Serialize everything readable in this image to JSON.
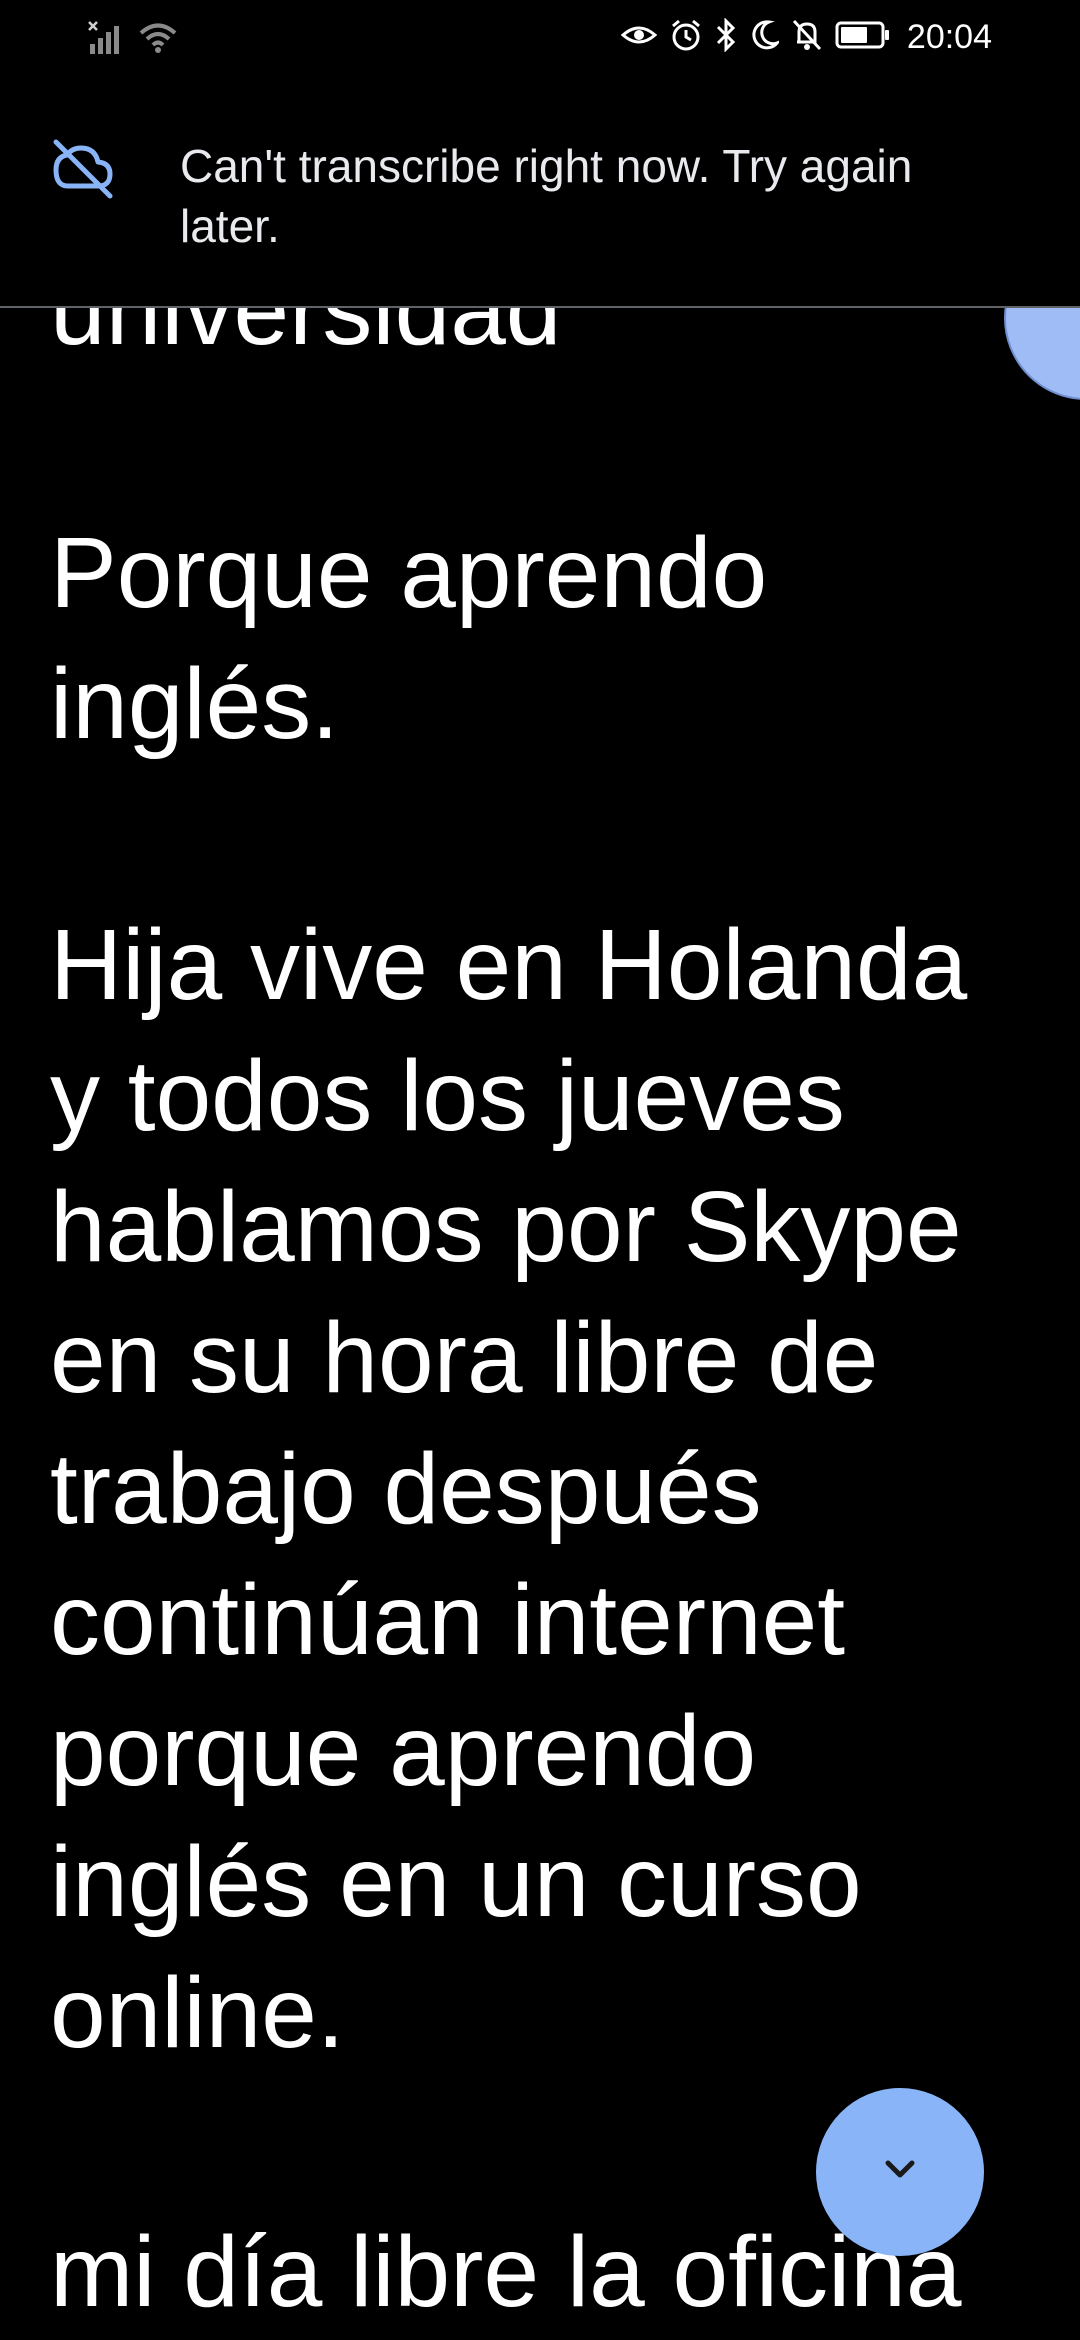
{
  "status_bar": {
    "time": "20:04",
    "icons": [
      "signal-icon",
      "wifi-icon",
      "eye-comfort-icon",
      "alarm-icon",
      "bluetooth-icon",
      "moon-icon",
      "notifications-off-icon",
      "battery-icon"
    ]
  },
  "banner": {
    "icon": "cloud-off-icon",
    "message": "Can't transcribe right now. Try again later."
  },
  "transcript": {
    "partial_top": "universidad",
    "paragraphs": [
      "Porque aprendo inglés.",
      "Hija vive en Holanda y todos los jueves hablamos por Skype en su hora libre de trabajo después continúan internet porque aprendo inglés en un curso online.",
      "mi día libre la oficina"
    ]
  },
  "scroll_button": {
    "icon": "chevron-down-icon"
  },
  "colors": {
    "background": "#000000",
    "text": "#ffffff",
    "accent": "#8ab4f8",
    "divider": "#5f6368"
  }
}
